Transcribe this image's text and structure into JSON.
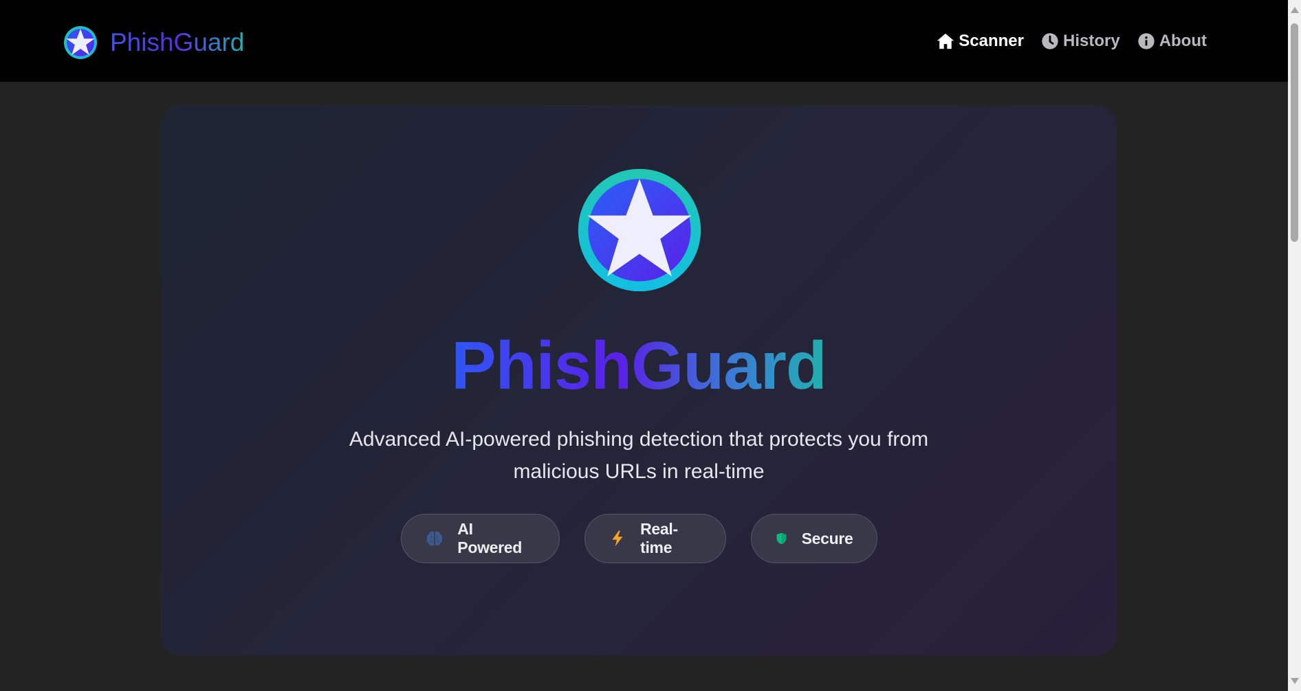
{
  "navbar": {
    "brand": "PhishGuard",
    "links": [
      {
        "label": "Scanner",
        "icon": "home-icon",
        "active": true
      },
      {
        "label": "History",
        "icon": "clock-icon",
        "active": false
      },
      {
        "label": "About",
        "icon": "info-icon",
        "active": false
      }
    ]
  },
  "hero": {
    "logo_icon": "star-shield-icon",
    "title": "PhishGuard",
    "subtitle": "Advanced AI-powered phishing detection that protects you from malicious URLs in real-time",
    "features": [
      {
        "label": "AI Powered",
        "icon": "brain-icon",
        "color": "#3b5b8c"
      },
      {
        "label": "Real-time",
        "icon": "lightning-icon",
        "color": "#f5a524"
      },
      {
        "label": "Secure",
        "icon": "shield-icon",
        "color": "#10b981"
      }
    ]
  },
  "colors": {
    "nav_background": "#000000",
    "page_background": "#232323",
    "brand_gradient": [
      "#2f56f5",
      "#5a20e6",
      "#22b0b0"
    ],
    "logo_ring": "#18c0c8"
  }
}
